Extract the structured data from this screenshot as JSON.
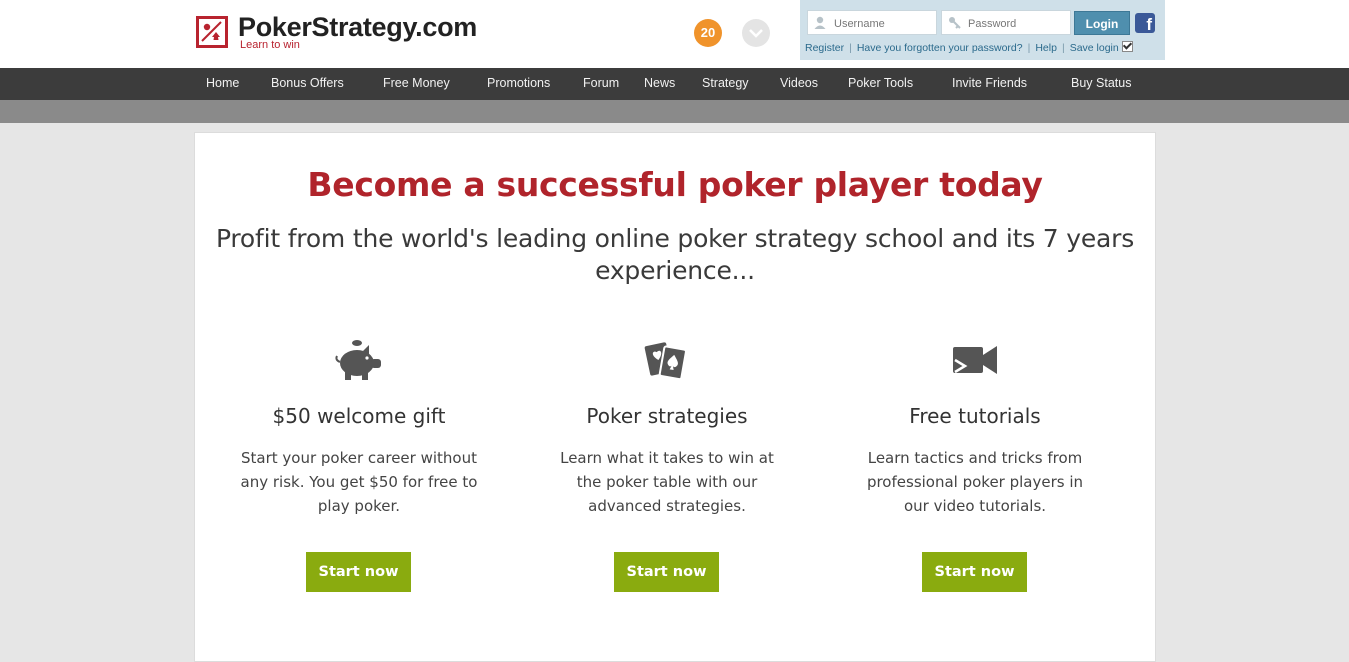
{
  "brand": {
    "name": "PokerStrategy.com",
    "tagline": "Learn to win",
    "color": "#b8232f"
  },
  "header": {
    "notification_count": "20",
    "dropdown_icon": "chevron-down-icon"
  },
  "login": {
    "username_placeholder": "Username",
    "password_placeholder": "Password",
    "login_label": "Login",
    "facebook_icon": "f",
    "links": {
      "register": "Register",
      "forgot": "Have you forgotten your password?",
      "help": "Help",
      "save_login": "Save login"
    },
    "save_login_checked": true
  },
  "nav": {
    "items": [
      {
        "label": "Home"
      },
      {
        "label": "Bonus Offers"
      },
      {
        "label": "Free Money"
      },
      {
        "label": "Promotions"
      },
      {
        "label": "Forum"
      },
      {
        "label": "News"
      },
      {
        "label": "Strategy"
      },
      {
        "label": "Videos"
      },
      {
        "label": "Poker Tools"
      },
      {
        "label": "Invite Friends"
      },
      {
        "label": "Buy Status"
      }
    ]
  },
  "main": {
    "headline": "Become a successful poker player today",
    "subhead_line1": "Profit from the world's leading online poker strategy school and its 7 years",
    "subhead_line2": "experience...",
    "features": [
      {
        "icon": "piggy-bank-icon",
        "title": "$50 welcome gift",
        "text": "Start your poker career without any risk. You get $50 for free to play poker.",
        "button": "Start now"
      },
      {
        "icon": "cards-icon",
        "title": "Poker strategies",
        "text": "Learn what it takes to win at the poker table with our advanced strategies.",
        "button": "Start now"
      },
      {
        "icon": "video-camera-icon",
        "title": "Free tutorials",
        "text": "Learn tactics and tricks from professional poker players in our video tutorials.",
        "button": "Start now"
      }
    ]
  },
  "colors": {
    "headline": "#b0242b",
    "button": "#8aab0f",
    "nav_bg": "#3c3c3c",
    "badge": "#f0932b",
    "login_bg": "#cfe0e9"
  }
}
